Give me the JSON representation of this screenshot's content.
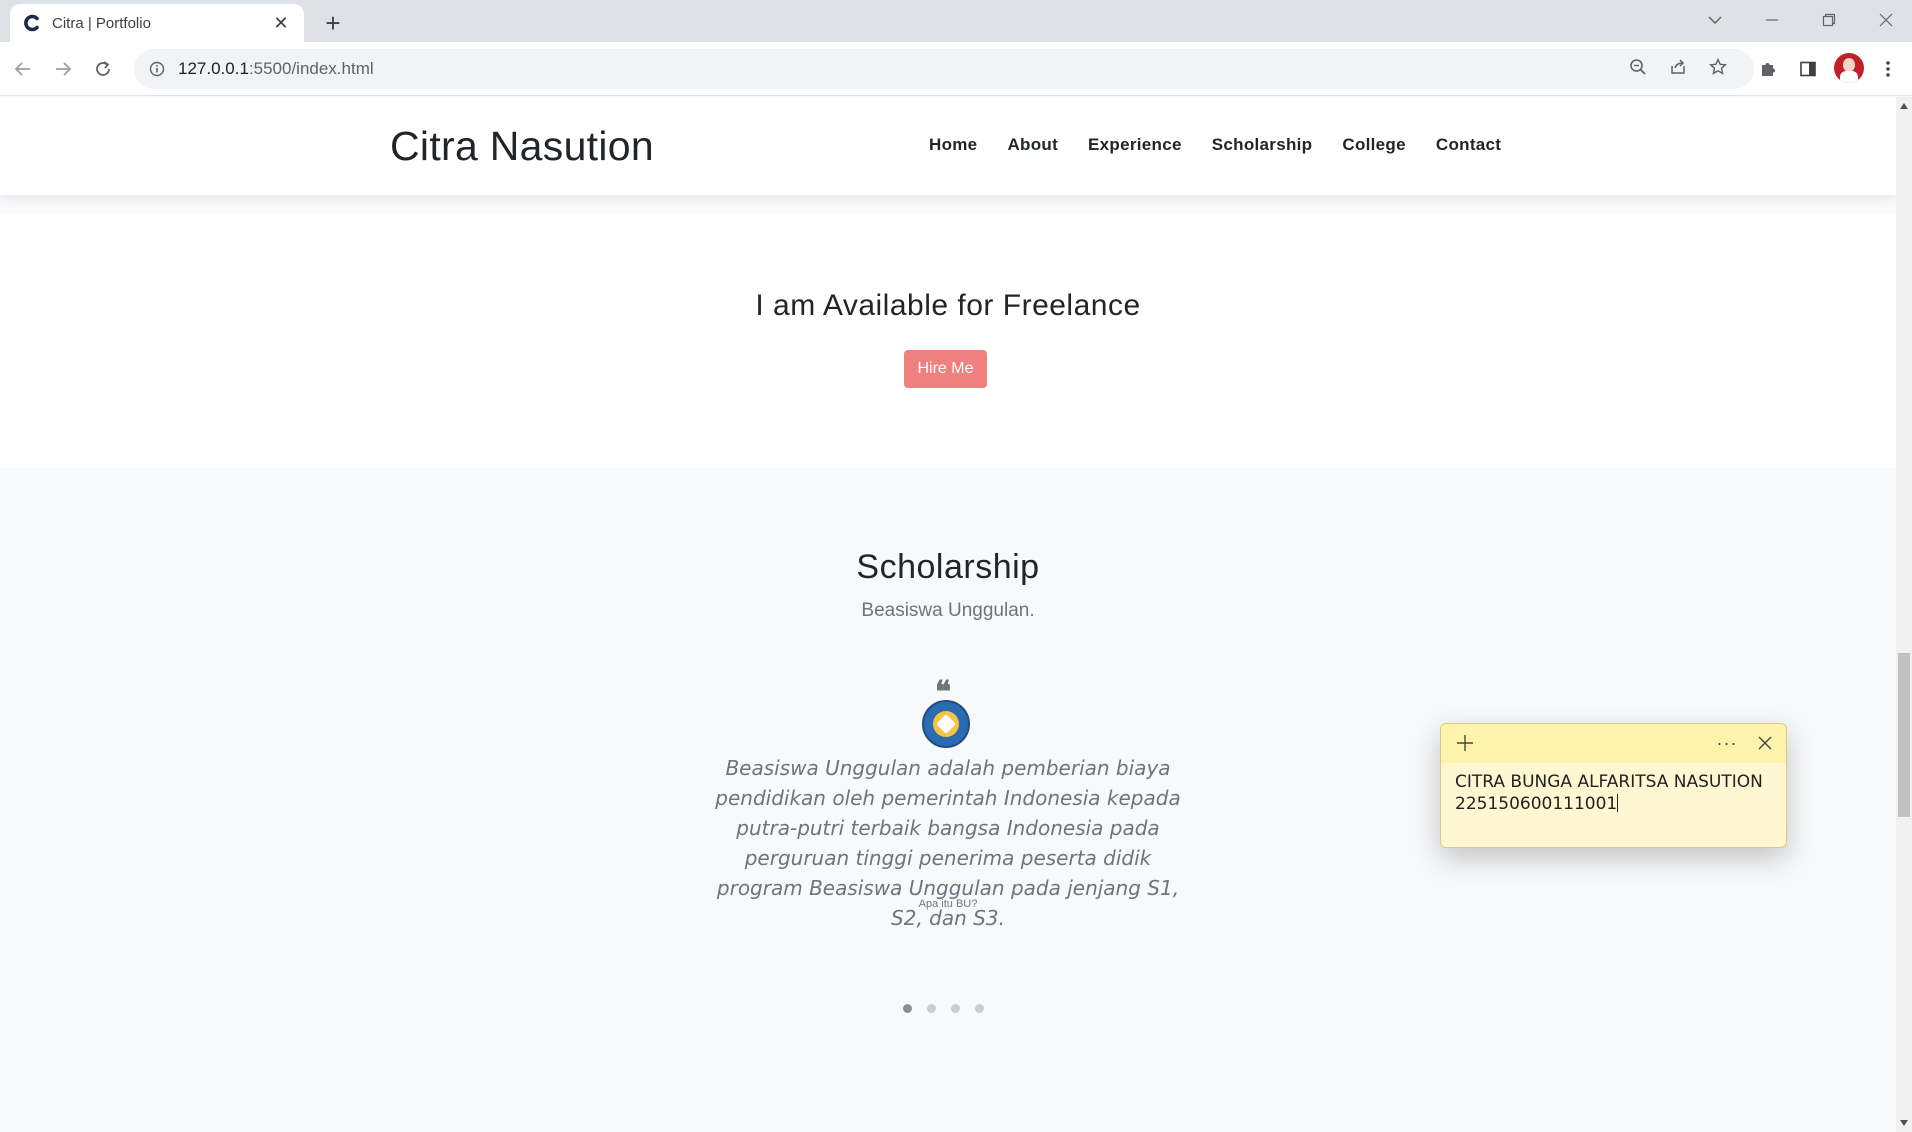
{
  "browser": {
    "tab_title": "Citra | Portfolio",
    "tab_close": "✕",
    "new_tab": "+",
    "url_host": "127.0.0.1",
    "url_path": ":5500/index.html"
  },
  "site": {
    "brand": "Citra Nasution",
    "nav": [
      "Home",
      "About",
      "Experience",
      "Scholarship",
      "College",
      "Contact"
    ]
  },
  "freelance": {
    "title": "I am Available for Freelance",
    "button": "Hire Me"
  },
  "scholarship": {
    "title": "Scholarship",
    "subtitle": "Beasiswa Unggulan.",
    "quote_mark": "❝",
    "quote": "Beasiswa Unggulan adalah pemberian biaya pendidikan oleh pemerintah Indonesia kepada putra-putri terbaik bangsa Indonesia pada perguruan tinggi penerima peserta didik program Beasiswa Unggulan pada jenjang S1, S2, dan S3.",
    "caption": "Apa itu BU?",
    "carousel_count": 4,
    "carousel_active": 1
  },
  "sticky_note": {
    "more": "···",
    "line1": "CITRA BUNGA ALFARITSA NASUTION",
    "line2": "225150600111001"
  },
  "colors": {
    "accent_button": "#f08080",
    "sticky_bg": "#fff7d1",
    "sticky_header": "#fff2ab"
  }
}
